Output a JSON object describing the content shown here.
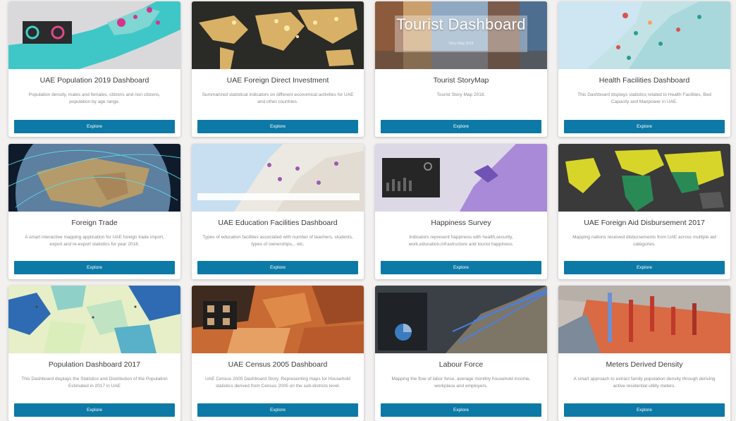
{
  "explore_label": "Explore",
  "cards": [
    {
      "title": "UAE Population 2019 Dashboard",
      "desc": "Population density, males and females, citizens and non citizens, population by age range."
    },
    {
      "title": "UAE Foreign Direct Investment",
      "desc": "Summarized statistical indicators on different economical activities for UAE and other countries."
    },
    {
      "title": "Tourist StoryMap",
      "desc": "Tourist Story Map 2018.",
      "overlay_title": "Tourist Dashboard",
      "overlay_sub": "Story Map 2018"
    },
    {
      "title": "Health Facilities Dashboard",
      "desc": "This Dashboard displays statistics related to Health Facilities, Bed Capacity and Manpower in UAE."
    },
    {
      "title": "Foreign Trade",
      "desc": "A smart interactive mapping application for UAE foreign trade import, export and re-export statistics for year 2018."
    },
    {
      "title": "UAE Education Facilities Dashboard",
      "desc": "Types of education facilities associated with number of teachers, students, types of ownerships,.. etc."
    },
    {
      "title": "Happiness Survey",
      "desc": "Indicators represent happiness with health,security, work,education,infrastructure and tourist happiness."
    },
    {
      "title": "UAE Foreign Aid Disbursement 2017",
      "desc": "Mapping nations received disbursements from UAE across multiple aid categories."
    },
    {
      "title": "Population Dashboard 2017",
      "desc": "This Dashboard displays the Statistics and Distribution of the Population Estimated in 2017 in UAE"
    },
    {
      "title": "UAE Census 2005 Dashboard",
      "desc": "UAE Census 2005 Dashboard Story. Representing maps for Household statistics derived from Census 2005 on the sub-districts level."
    },
    {
      "title": "Labour Force",
      "desc": "Mapping the flow of labor force, average monthly household income, workplace and employers."
    },
    {
      "title": "Meters Derived Density",
      "desc": "A smart approach to extract family population density through deriving active residential utility meters."
    }
  ]
}
